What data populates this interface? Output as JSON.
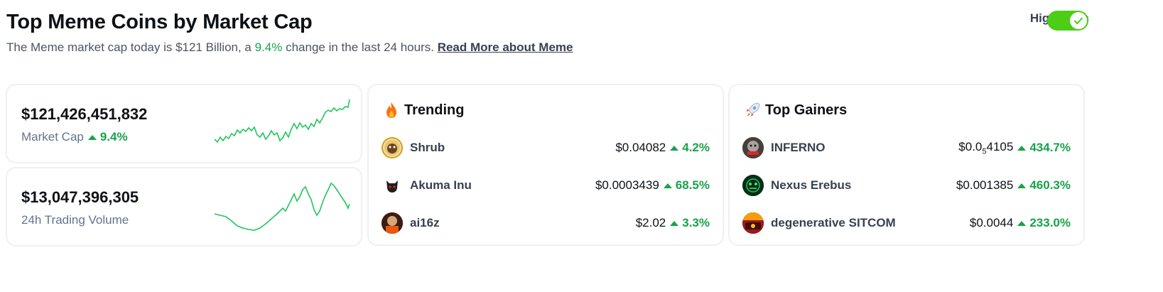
{
  "header": {
    "title": "Top Meme Coins by Market Cap",
    "subtitle_prefix": "The Meme market cap today is $121 Billion, a ",
    "subtitle_pct": "9.4%",
    "subtitle_suffix": " change in the last 24 hours. ",
    "read_more": "Read More about Meme",
    "highlights_label": "Highlights",
    "highlights_on": true
  },
  "stats": {
    "market_cap": {
      "value": "$121,426,451,832",
      "label": "Market Cap",
      "change": "9.4%"
    },
    "volume": {
      "value": "$13,047,396,305",
      "label": "24h Trading Volume"
    }
  },
  "trending": {
    "title": "Trending",
    "icon": "fire-icon",
    "items": [
      {
        "name": "Shrub",
        "price": "$0.04082",
        "change": "4.2%"
      },
      {
        "name": "Akuma Inu",
        "price": "$0.0003439",
        "change": "68.5%"
      },
      {
        "name": "ai16z",
        "price": "$2.02",
        "change": "3.3%"
      }
    ]
  },
  "top_gainers": {
    "title": "Top Gainers",
    "icon": "rocket-icon",
    "items": [
      {
        "name": "INFERNO",
        "price_prefix": "$0.0",
        "price_sub": "5",
        "price_suffix": "4105",
        "change": "434.7%"
      },
      {
        "name": "Nexus Erebus",
        "price": "$0.001385",
        "change": "460.3%"
      },
      {
        "name": "degenerative SITCOM",
        "price": "$0.0044",
        "change": "233.0%"
      }
    ]
  },
  "colors": {
    "up": "#16a34a",
    "toggle": "#4ccd16",
    "spark": "#22c55e"
  }
}
